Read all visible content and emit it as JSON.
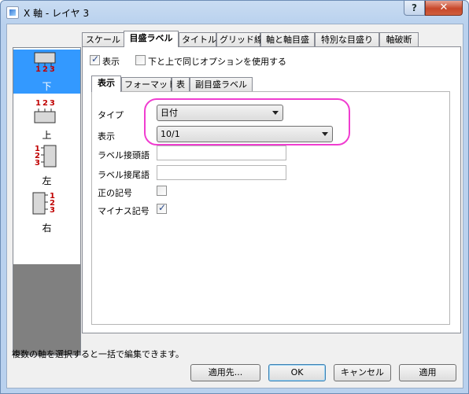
{
  "window": {
    "title": "X 軸 - レイヤ 3"
  },
  "axes": [
    {
      "label": "下",
      "nums": "123"
    },
    {
      "label": "上",
      "nums": "123"
    },
    {
      "label": "左",
      "nums": [
        "1",
        "2",
        "3"
      ]
    },
    {
      "label": "右",
      "nums": [
        "1",
        "2",
        "3"
      ]
    }
  ],
  "tabs": [
    "スケール",
    "目盛ラベル",
    "タイトル",
    "グリッド線",
    "軸と軸目盛",
    "特別な目盛り",
    "軸破断"
  ],
  "options": {
    "show_label": "表示",
    "same_option_label": "下と上で同じオプションを使用する"
  },
  "subtabs": [
    "表示",
    "フォーマット",
    "表",
    "副目盛ラベル"
  ],
  "form": {
    "type_label": "タイプ",
    "type_value": "日付",
    "display_label": "表示",
    "display_value": "10/1",
    "prefix_label": "ラベル接頭語",
    "suffix_label": "ラベル接尾語",
    "plus_label": "正の記号",
    "minus_label": "マイナス記号"
  },
  "status_text": "複数の軸を選択すると一括で編集できます。",
  "buttons": {
    "apply_to": "適用先...",
    "ok": "OK",
    "cancel": "キャンセル",
    "apply": "適用"
  }
}
